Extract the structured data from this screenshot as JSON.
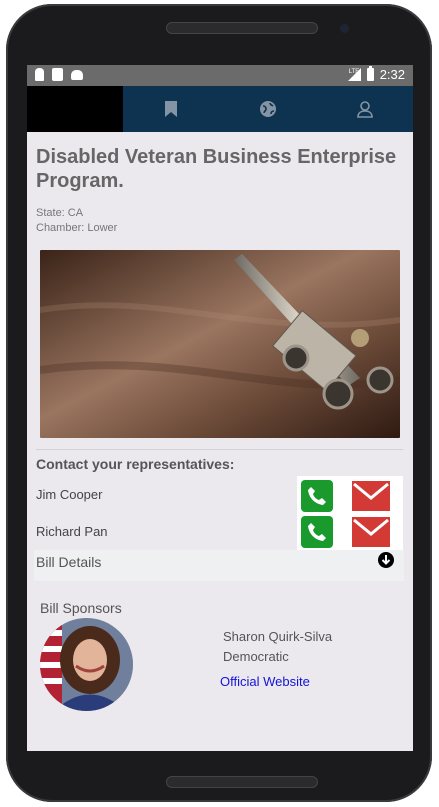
{
  "status_bar": {
    "time": "2:32",
    "network": "LTE",
    "left_icons": [
      "person-icon",
      "sd-card-icon",
      "android-icon"
    ]
  },
  "top_nav": {
    "tabs": [
      {
        "icon": "bookmark-icon"
      },
      {
        "icon": "globe-icon"
      },
      {
        "icon": "user-icon"
      }
    ],
    "background": "#0d3350"
  },
  "bill": {
    "title": "Disabled Veteran Business Enterprise Program.",
    "state": "State: CA",
    "chamber": "Chamber: Lower"
  },
  "contact": {
    "heading": "Contact your representatives:",
    "representatives": [
      {
        "name": "Jim Cooper"
      },
      {
        "name": "Richard Pan"
      }
    ]
  },
  "details": {
    "label": "Bill Details",
    "icon": "circle-arrow-down-icon"
  },
  "sponsors": {
    "heading": "Bill Sponsors",
    "items": [
      {
        "name": "Sharon Quirk-Silva",
        "party": "Democratic",
        "link_text": "Official Website"
      }
    ]
  },
  "colors": {
    "call": "#1a9a2c",
    "email": "#d33a35",
    "link": "#1414d6",
    "content_bg": "#ebe8ee"
  }
}
